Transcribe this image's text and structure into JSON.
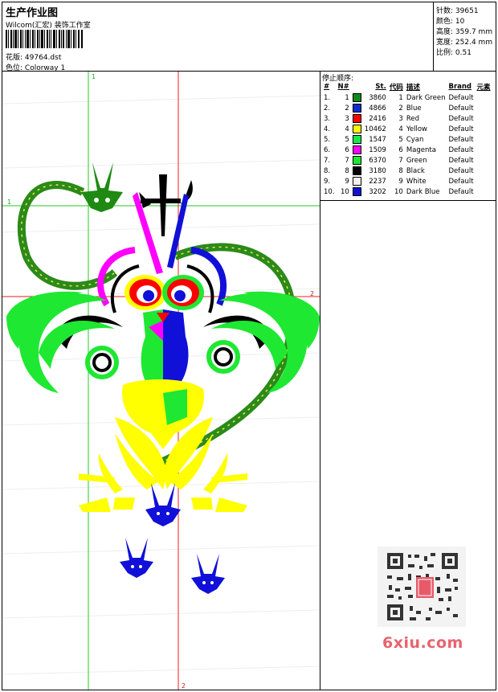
{
  "header": {
    "title": "生产作业图",
    "subtitle": "Wilcom(汇宏) 装饰工作室",
    "design_label": "花版:",
    "design_value": "49764.dst",
    "colorway_label": "色位:",
    "colorway_value": "Colorway 1"
  },
  "stats": [
    {
      "label": "针数:",
      "value": "39651"
    },
    {
      "label": "颜色:",
      "value": "10"
    },
    {
      "label": "高度:",
      "value": "359.7 mm"
    },
    {
      "label": "宽度:",
      "value": "252.4 mm"
    },
    {
      "label": "比例:",
      "value": "0.51"
    }
  ],
  "guides": {
    "v1": "1",
    "h1": "1",
    "h2": "2",
    "v2": "2"
  },
  "stop_sequence": {
    "title": "停止顺序:",
    "headers": [
      "#",
      "N#",
      "St.",
      "代码",
      "描述",
      "Brand",
      "元素"
    ],
    "rows": [
      {
        "idx": "1.",
        "n": "1",
        "color": "#0c8a1a",
        "st": "3860",
        "code": "1",
        "desc": "Dark Green",
        "brand": "Default"
      },
      {
        "idx": "2.",
        "n": "2",
        "color": "#0a2fd1",
        "st": "4866",
        "code": "2",
        "desc": "Blue",
        "brand": "Default"
      },
      {
        "idx": "3.",
        "n": "3",
        "color": "#ff0000",
        "st": "2416",
        "code": "3",
        "desc": "Red",
        "brand": "Default"
      },
      {
        "idx": "4.",
        "n": "4",
        "color": "#ffff00",
        "st": "10462",
        "code": "4",
        "desc": "Yellow",
        "brand": "Default"
      },
      {
        "idx": "5.",
        "n": "5",
        "color": "#17e84a",
        "st": "1547",
        "code": "5",
        "desc": "Cyan",
        "brand": "Default"
      },
      {
        "idx": "6.",
        "n": "6",
        "color": "#ff00ff",
        "st": "1509",
        "code": "6",
        "desc": "Magenta",
        "brand": "Default"
      },
      {
        "idx": "7.",
        "n": "7",
        "color": "#1ee832",
        "st": "6370",
        "code": "7",
        "desc": "Green",
        "brand": "Default"
      },
      {
        "idx": "8.",
        "n": "8",
        "color": "#000000",
        "st": "3180",
        "code": "8",
        "desc": "Black",
        "brand": "Default"
      },
      {
        "idx": "9.",
        "n": "9",
        "color": "#f2f2f2",
        "st": "2237",
        "code": "9",
        "desc": "White",
        "brand": "Default"
      },
      {
        "idx": "10.",
        "n": "10",
        "color": "#1010d8",
        "st": "3202",
        "code": "10",
        "desc": "Dark Blue",
        "brand": "Default"
      }
    ]
  },
  "watermark": {
    "site": "6xiu.com"
  }
}
